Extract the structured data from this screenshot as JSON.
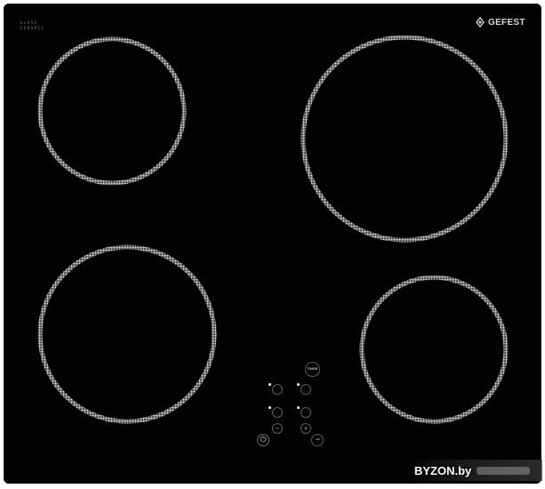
{
  "hob": {
    "brand_name": "GEFEST",
    "brand_icon": "gefest-flame-icon",
    "glass_label_line1": "GLASS",
    "glass_label_line2": "CERAMIC",
    "glass_color": "#020202",
    "ring_color": "#c9c9c9"
  },
  "controls": {
    "timer_label": "TIMER",
    "power_label": "⏻",
    "minus_label": "−",
    "plus_label": "+",
    "lock_label": "⊸",
    "indicator_color": "#ffffff"
  },
  "watermark": {
    "text": "BYZON.by"
  }
}
